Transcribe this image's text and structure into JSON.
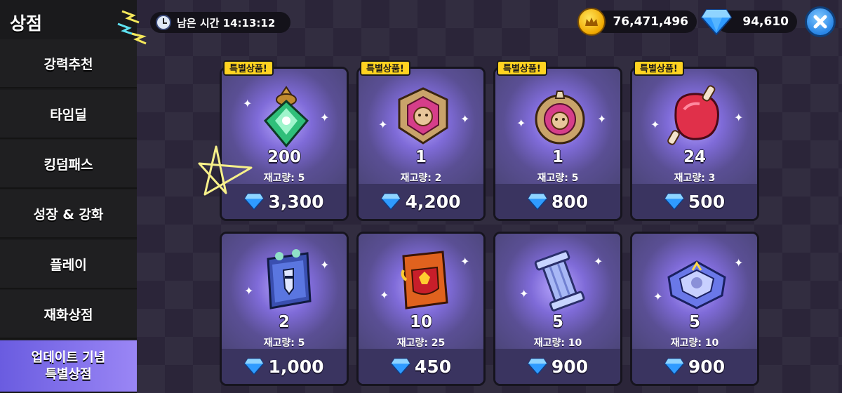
{
  "sidebar": {
    "title": "상점",
    "items": [
      {
        "label": "강력추천"
      },
      {
        "label": "타임딜"
      },
      {
        "label": "킹덤패스"
      },
      {
        "label": "성장 & 강화"
      },
      {
        "label": "플레이"
      },
      {
        "label": "재화상점"
      },
      {
        "label_line1": "업데이트 기념",
        "label_line2": "특별상점"
      }
    ]
  },
  "header": {
    "timer_label": "남은 시간 14:13:12",
    "coins": "76,471,496",
    "gems": "94,610"
  },
  "badge_label": "특별상품!",
  "cards": [
    {
      "qty": "200",
      "stock": "재고량: 5",
      "price": "3,300",
      "icon": "green-gem-crystal-icon"
    },
    {
      "qty": "1",
      "stock": "재고량: 2",
      "price": "4,200",
      "icon": "pink-cookie-medal-icon"
    },
    {
      "qty": "1",
      "stock": "재고량: 5",
      "price": "800",
      "icon": "pink-cookie-medal-6-icon"
    },
    {
      "qty": "24",
      "stock": "재고량: 3",
      "price": "500",
      "icon": "meat-jelly-icon"
    },
    {
      "qty": "2",
      "stock": "재고량: 5",
      "price": "1,000",
      "icon": "blue-sword-book-icon"
    },
    {
      "qty": "10",
      "stock": "재고량: 25",
      "price": "450",
      "icon": "orange-emblem-book-icon"
    },
    {
      "qty": "5",
      "stock": "재고량: 10",
      "price": "900",
      "icon": "pillar-material-icon"
    },
    {
      "qty": "5",
      "stock": "재고량: 10",
      "price": "900",
      "icon": "blue-frame-material-icon"
    }
  ],
  "colors": {
    "sidebar_bg": "#1f1f21",
    "active_item": "#8a78f0",
    "card_bg": "#504a7a",
    "badge": "#ffd321",
    "gem": "#3aa8ff",
    "coin": "#f0a800",
    "close_button": "#2a86e6"
  }
}
